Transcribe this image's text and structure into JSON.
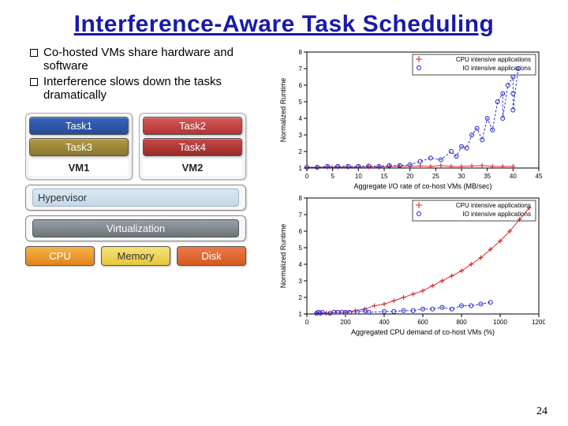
{
  "title": "Interference-Aware Task Scheduling",
  "page_number": "24",
  "bullets": [
    "Co-hosted VMs share hardware and software",
    "Interference slows down the tasks dramatically"
  ],
  "diagram": {
    "tasks": {
      "t1": "Task1",
      "t2": "Task2",
      "t3": "Task3",
      "t4": "Task4"
    },
    "vms": {
      "vm1": "VM1",
      "vm2": "VM2"
    },
    "layers": {
      "hypervisor": "Hypervisor",
      "virt": "Virtualization"
    },
    "hw": {
      "cpu": "CPU",
      "mem": "Memory",
      "disk": "Disk"
    }
  },
  "chart_data": [
    {
      "type": "scatter",
      "title": "",
      "legend": [
        "CPU intensive applications",
        "IO intensive applications"
      ],
      "legend_markers": [
        "+",
        "o"
      ],
      "xlabel": "Aggregate I/O rate of co-host VMs (MB/sec)",
      "ylabel": "Normalized Runtime",
      "xlim": [
        0,
        45
      ],
      "ylim": [
        1,
        8
      ],
      "xticks": [
        0,
        5,
        10,
        15,
        20,
        25,
        30,
        35,
        40,
        45
      ],
      "yticks": [
        1,
        2,
        3,
        4,
        5,
        6,
        7,
        8
      ],
      "series": [
        {
          "name": "CPU intensive applications",
          "marker": "+",
          "color": "#d02020",
          "points": [
            [
              0,
              1.05
            ],
            [
              2,
              1.05
            ],
            [
              4,
              1.05
            ],
            [
              6,
              1.06
            ],
            [
              8,
              1.05
            ],
            [
              10,
              1.05
            ],
            [
              12,
              1.07
            ],
            [
              14,
              1.05
            ],
            [
              16,
              1.09
            ],
            [
              18,
              1.1
            ],
            [
              20,
              1.1
            ],
            [
              22,
              1.12
            ],
            [
              24,
              1.1
            ],
            [
              26,
              1.15
            ],
            [
              28,
              1.1
            ],
            [
              30,
              1.1
            ],
            [
              32,
              1.12
            ],
            [
              34,
              1.15
            ],
            [
              36,
              1.1
            ],
            [
              38,
              1.1
            ],
            [
              40,
              1.1
            ]
          ]
        },
        {
          "name": "IO intensive applications",
          "marker": "o",
          "color": "#2020d0",
          "points": [
            [
              0,
              1.05
            ],
            [
              2,
              1.05
            ],
            [
              4,
              1.1
            ],
            [
              6,
              1.1
            ],
            [
              8,
              1.1
            ],
            [
              10,
              1.1
            ],
            [
              12,
              1.12
            ],
            [
              14,
              1.1
            ],
            [
              16,
              1.15
            ],
            [
              18,
              1.15
            ],
            [
              20,
              1.2
            ],
            [
              22,
              1.4
            ],
            [
              24,
              1.6
            ],
            [
              26,
              1.5
            ],
            [
              28,
              2.0
            ],
            [
              29,
              1.7
            ],
            [
              30,
              2.3
            ],
            [
              31,
              2.2
            ],
            [
              32,
              3.0
            ],
            [
              33,
              3.4
            ],
            [
              34,
              2.7
            ],
            [
              35,
              4.0
            ],
            [
              36,
              3.3
            ],
            [
              37,
              5.0
            ],
            [
              38,
              5.5
            ],
            [
              39,
              6.0
            ],
            [
              40,
              6.5
            ],
            [
              40,
              5.5
            ],
            [
              40,
              4.5
            ],
            [
              41,
              7.0
            ],
            [
              38,
              4.0
            ]
          ]
        }
      ]
    },
    {
      "type": "scatter",
      "title": "",
      "legend": [
        "CPU intensive applications",
        "IO intensive applications"
      ],
      "legend_markers": [
        "+",
        "o"
      ],
      "xlabel": "Aggregated CPU demand of co-host VMs (%)",
      "ylabel": "Normalized Runtime",
      "xlim": [
        0,
        1200
      ],
      "ylim": [
        1,
        8
      ],
      "xticks": [
        0,
        200,
        400,
        600,
        800,
        1000,
        1200
      ],
      "yticks": [
        1,
        2,
        3,
        4,
        5,
        6,
        7,
        8
      ],
      "series": [
        {
          "name": "CPU intensive applications",
          "marker": "+",
          "color": "#d02020",
          "points": [
            [
              50,
              1.05
            ],
            [
              100,
              1.05
            ],
            [
              150,
              1.1
            ],
            [
              200,
              1.1
            ],
            [
              250,
              1.2
            ],
            [
              300,
              1.3
            ],
            [
              350,
              1.5
            ],
            [
              400,
              1.6
            ],
            [
              450,
              1.8
            ],
            [
              500,
              2.0
            ],
            [
              550,
              2.2
            ],
            [
              600,
              2.4
            ],
            [
              650,
              2.7
            ],
            [
              700,
              3.0
            ],
            [
              750,
              3.3
            ],
            [
              800,
              3.6
            ],
            [
              850,
              4.0
            ],
            [
              900,
              4.4
            ],
            [
              950,
              4.9
            ],
            [
              1000,
              5.4
            ],
            [
              1050,
              6.0
            ],
            [
              1100,
              6.7
            ],
            [
              1150,
              7.4
            ]
          ]
        },
        {
          "name": "IO intensive applications",
          "marker": "o",
          "color": "#2020d0",
          "points": [
            [
              50,
              1.05
            ],
            [
              60,
              1.1
            ],
            [
              70,
              1.05
            ],
            [
              80,
              1.1
            ],
            [
              120,
              1.05
            ],
            [
              140,
              1.1
            ],
            [
              160,
              1.1
            ],
            [
              180,
              1.12
            ],
            [
              200,
              1.1
            ],
            [
              220,
              1.1
            ],
            [
              260,
              1.12
            ],
            [
              300,
              1.2
            ],
            [
              320,
              1.1
            ],
            [
              400,
              1.15
            ],
            [
              450,
              1.15
            ],
            [
              500,
              1.2
            ],
            [
              550,
              1.2
            ],
            [
              600,
              1.3
            ],
            [
              650,
              1.3
            ],
            [
              700,
              1.4
            ],
            [
              750,
              1.3
            ],
            [
              800,
              1.5
            ],
            [
              850,
              1.5
            ],
            [
              900,
              1.6
            ],
            [
              950,
              1.7
            ]
          ]
        }
      ]
    }
  ]
}
